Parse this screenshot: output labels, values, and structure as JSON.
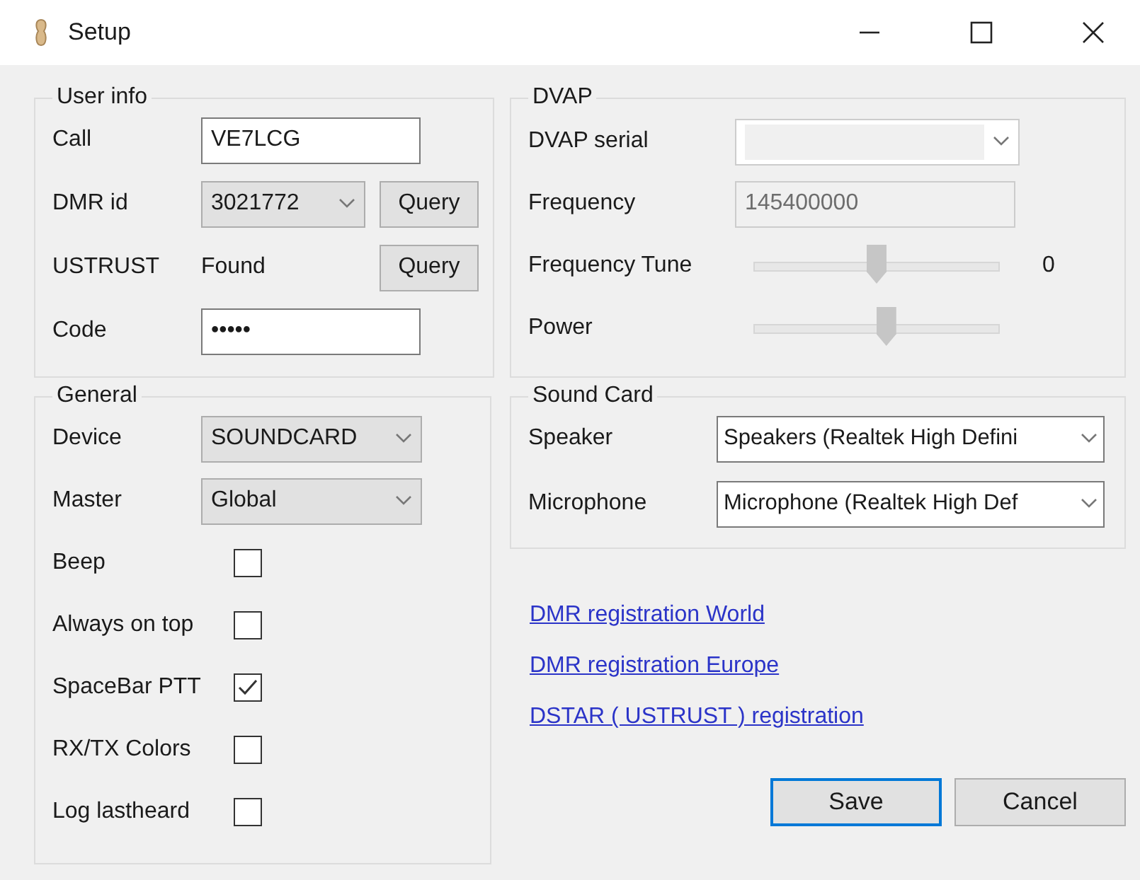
{
  "window": {
    "title": "Setup"
  },
  "user_info": {
    "title": "User info",
    "rows": [
      {
        "kind": "text",
        "label": "Call",
        "value": "VE7LCG"
      },
      {
        "kind": "dropdown",
        "label": "DMR id",
        "value": "3021772",
        "button": "Query"
      },
      {
        "kind": "status",
        "label": "USTRUST",
        "value": "Found",
        "button": "Query"
      },
      {
        "kind": "text",
        "label": "Code",
        "value": "•••••"
      }
    ]
  },
  "dvap": {
    "title": "DVAP",
    "rows": [
      {
        "kind": "combo",
        "label": "DVAP serial",
        "disabled": true
      },
      {
        "kind": "text",
        "label": "Frequency",
        "value": "145400000",
        "disabled": true
      },
      {
        "kind": "slider",
        "label": "Frequency Tune",
        "level": 0.5,
        "reading": "0"
      },
      {
        "kind": "slider",
        "label": "Power",
        "level": 0.54
      }
    ]
  },
  "general": {
    "title": "General",
    "rows": [
      {
        "kind": "dropdown",
        "label": "Device",
        "value": "SOUNDCARD"
      },
      {
        "kind": "dropdown",
        "label": "Master",
        "value": "Global"
      },
      {
        "kind": "checkbox",
        "label": "Beep",
        "checked": false
      },
      {
        "kind": "checkbox",
        "label": "Always on top",
        "checked": false
      },
      {
        "kind": "checkbox",
        "label": "SpaceBar PTT",
        "checked": true
      },
      {
        "kind": "checkbox",
        "label": "RX/TX Colors",
        "checked": false
      },
      {
        "kind": "checkbox",
        "label": "Log lastheard",
        "checked": false
      }
    ]
  },
  "sound_card": {
    "title": "Sound Card",
    "rows": [
      {
        "kind": "combo",
        "label": "Speaker",
        "value": "Speakers (Realtek High Defini"
      },
      {
        "kind": "combo",
        "label": "Microphone",
        "value": "Microphone (Realtek High Def"
      }
    ]
  },
  "links": [
    "DMR registration World",
    "DMR registration Europe",
    "DSTAR ( USTRUST ) registration"
  ],
  "buttons": [
    {
      "label": "Save",
      "focused": true
    },
    {
      "label": "Cancel",
      "focused": false
    }
  ]
}
